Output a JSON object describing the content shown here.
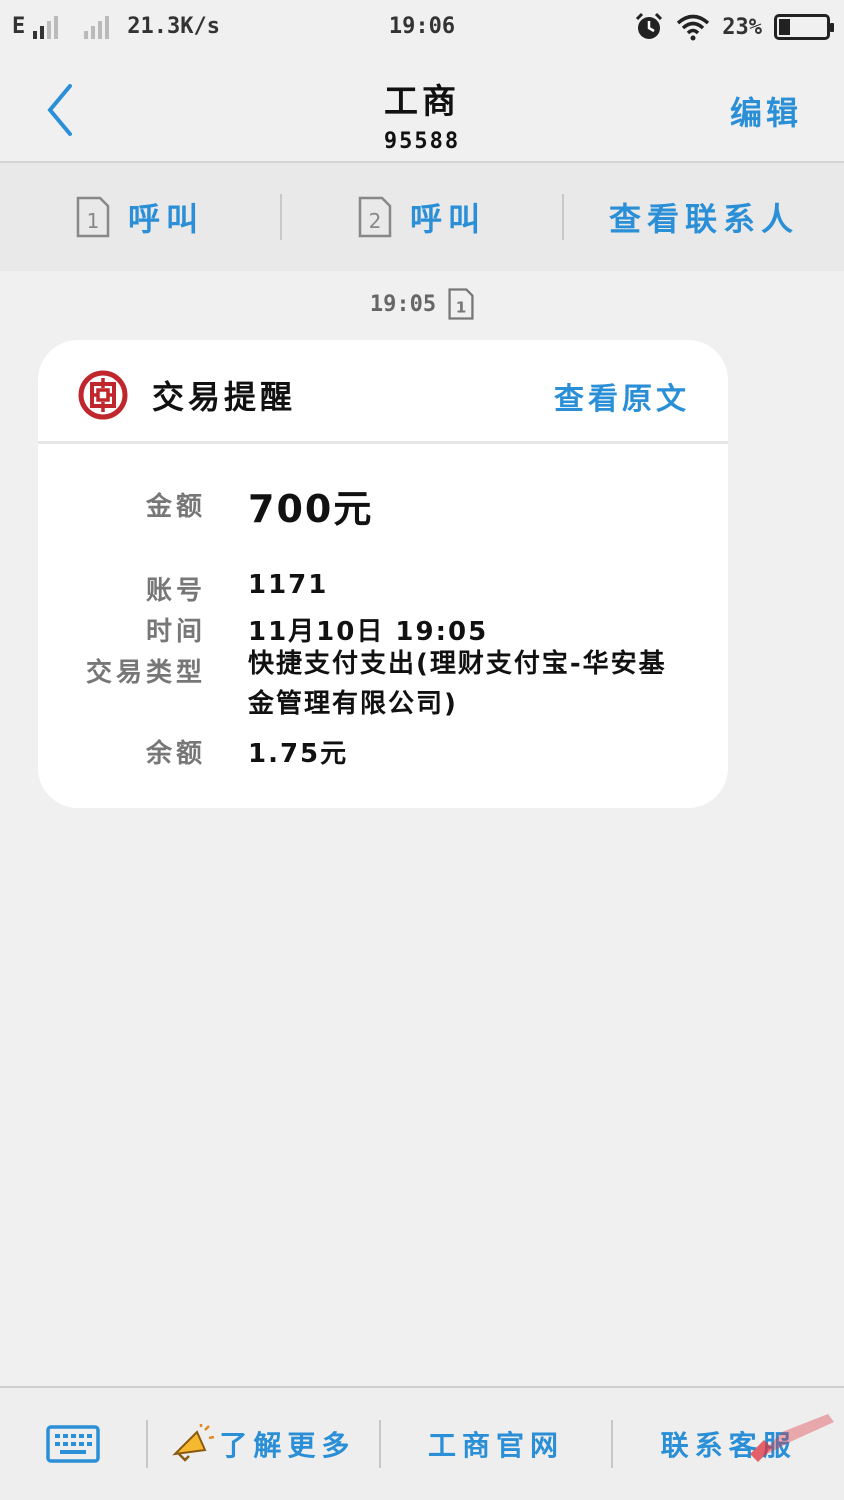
{
  "status_bar": {
    "net_type": "E",
    "speed": "21.3K/s",
    "time": "19:06",
    "battery_percent": "23%",
    "battery_level": 0.23
  },
  "header": {
    "title": "工商",
    "number": "95588",
    "edit_label": "编辑"
  },
  "actions": {
    "call1_label": "呼叫",
    "call1_sim": "1",
    "call2_label": "呼叫",
    "call2_sim": "2",
    "view_contact_label": "查看联系人"
  },
  "message": {
    "time": "19:05",
    "sim": "1",
    "card": {
      "title": "交易提醒",
      "view_original_label": "查看原文",
      "fields": {
        "amount_label": "金额",
        "amount_value": "700元",
        "account_label": "账号",
        "account_value": "1171",
        "time_label": "时间",
        "time_value": "11月10日 19:05",
        "type_label": "交易类型",
        "type_value": "快捷支付支出(理财支付宝-华安基金管理有限公司)",
        "balance_label": "余额",
        "balance_value": "1.75元"
      }
    }
  },
  "bottom_bar": {
    "learn_more_label": "了解更多",
    "official_site_label": "工商官网",
    "contact_service_label": "联系客服"
  },
  "colors": {
    "accent": "#2a8fd6",
    "bank_red": "#c0272d"
  },
  "icons": [
    "back-chevron-icon",
    "sim-card-icon",
    "alarm-icon",
    "wifi-icon",
    "battery-icon",
    "bank-logo-icon",
    "keyboard-icon",
    "megaphone-icon",
    "watermark-logo"
  ]
}
